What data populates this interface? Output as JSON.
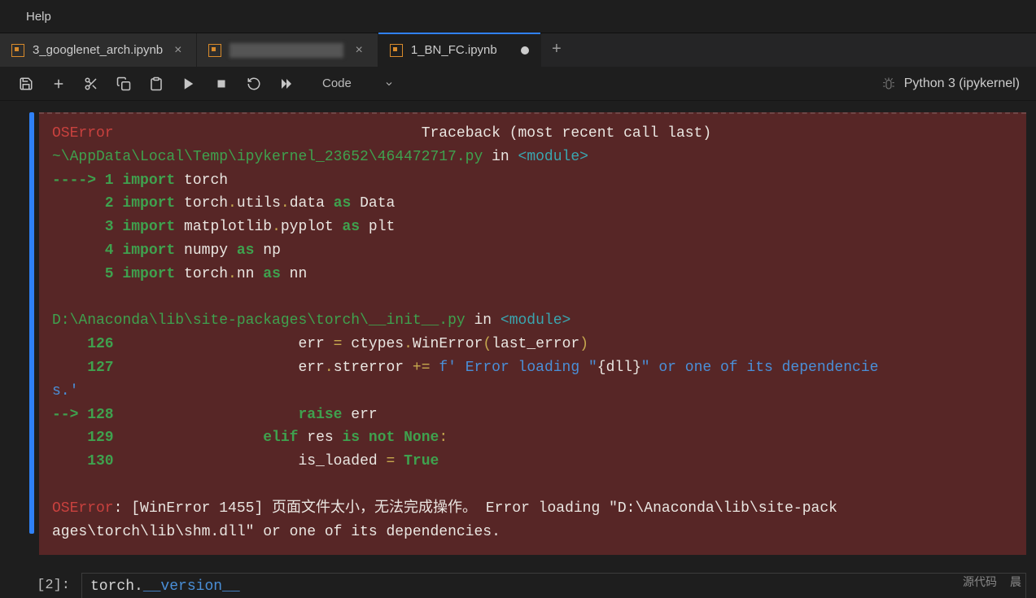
{
  "menubar": {
    "help": "Help"
  },
  "tabs": {
    "items": [
      {
        "label": "3_googlenet_arch.ipynb",
        "state": "closeable"
      },
      {
        "label": "",
        "state": "closeable",
        "redacted": true
      },
      {
        "label": "1_BN_FC.ipynb",
        "state": "dirty",
        "active": true
      }
    ]
  },
  "toolbar": {
    "cell_type": "Code",
    "kernel": "Python 3 (ipykernel)"
  },
  "traceback": {
    "error_class": "OSError",
    "traceback_label": "Traceback (most recent call last)",
    "frame1_path": "~\\AppData\\Local\\Temp\\ipykernel_23652\\464472717.py",
    "in_label": " in ",
    "module_label": "<module>",
    "arrow1": "----> 1 ",
    "line1_kw": "import",
    "line1_rest": " torch",
    "line2_num": "      2 ",
    "line2_kw": "import",
    "line2_a": " torch",
    "line2_b": "utils",
    "line2_c": "data ",
    "line2_as": "as",
    "line2_d": " Data",
    "line3_num": "      3 ",
    "line3_kw": "import",
    "line3_a": " matplotlib",
    "line3_b": "pyplot ",
    "line3_as": "as",
    "line3_c": " plt",
    "line4_num": "      4 ",
    "line4_kw": "import",
    "line4_a": " numpy ",
    "line4_as": "as",
    "line4_b": " np",
    "line5_num": "      5 ",
    "line5_kw": "import",
    "line5_a": " torch",
    "line5_b": "nn ",
    "line5_as": "as",
    "line5_c": " nn",
    "frame2_path": "D:\\Anaconda\\lib\\site-packages\\torch\\__init__.py",
    "f2_l126_num": "    126 ",
    "f2_l126_code_a": "                    err ",
    "f2_l126_code_b": " ctypes",
    "f2_l126_code_c": "WinError",
    "f2_l126_code_d": "last_error",
    "f2_l127_num": "    127 ",
    "f2_l127_code_a": "                    err",
    "f2_l127_code_b": "strerror ",
    "f2_l127_fstr": "f' Error loading \"",
    "f2_l127_var": "{dll}",
    "f2_l127_fstr2": "\" or one of its dependencie",
    "f2_l127_cont": "s.'",
    "f2_l128_arrow": "--> 128 ",
    "f2_l128_code_a": "                    ",
    "f2_l128_raise": "raise",
    "f2_l128_code_b": " err",
    "f2_l129_num": "    129 ",
    "f2_l129_code_a": "                ",
    "f2_l129_elif": "elif",
    "f2_l129_code_b": " res ",
    "f2_l129_isnot": "is not None",
    "f2_l130_num": "    130 ",
    "f2_l130_code_a": "                    is_loaded ",
    "f2_l130_true": "True",
    "final_error": "OSError",
    "final_msg1": ": [WinError 1455] 页面文件太小，无法完成操作。 Error loading \"D:\\Anaconda\\lib\\site-pack",
    "final_msg2": "ages\\torch\\lib\\shm.dll\" or one of its dependencies."
  },
  "next_cell": {
    "prompt": "[2]:",
    "code_var": "torch",
    "code_dunder": "__version__"
  },
  "statusbar": {
    "src": "源代码",
    "other": "晨"
  }
}
